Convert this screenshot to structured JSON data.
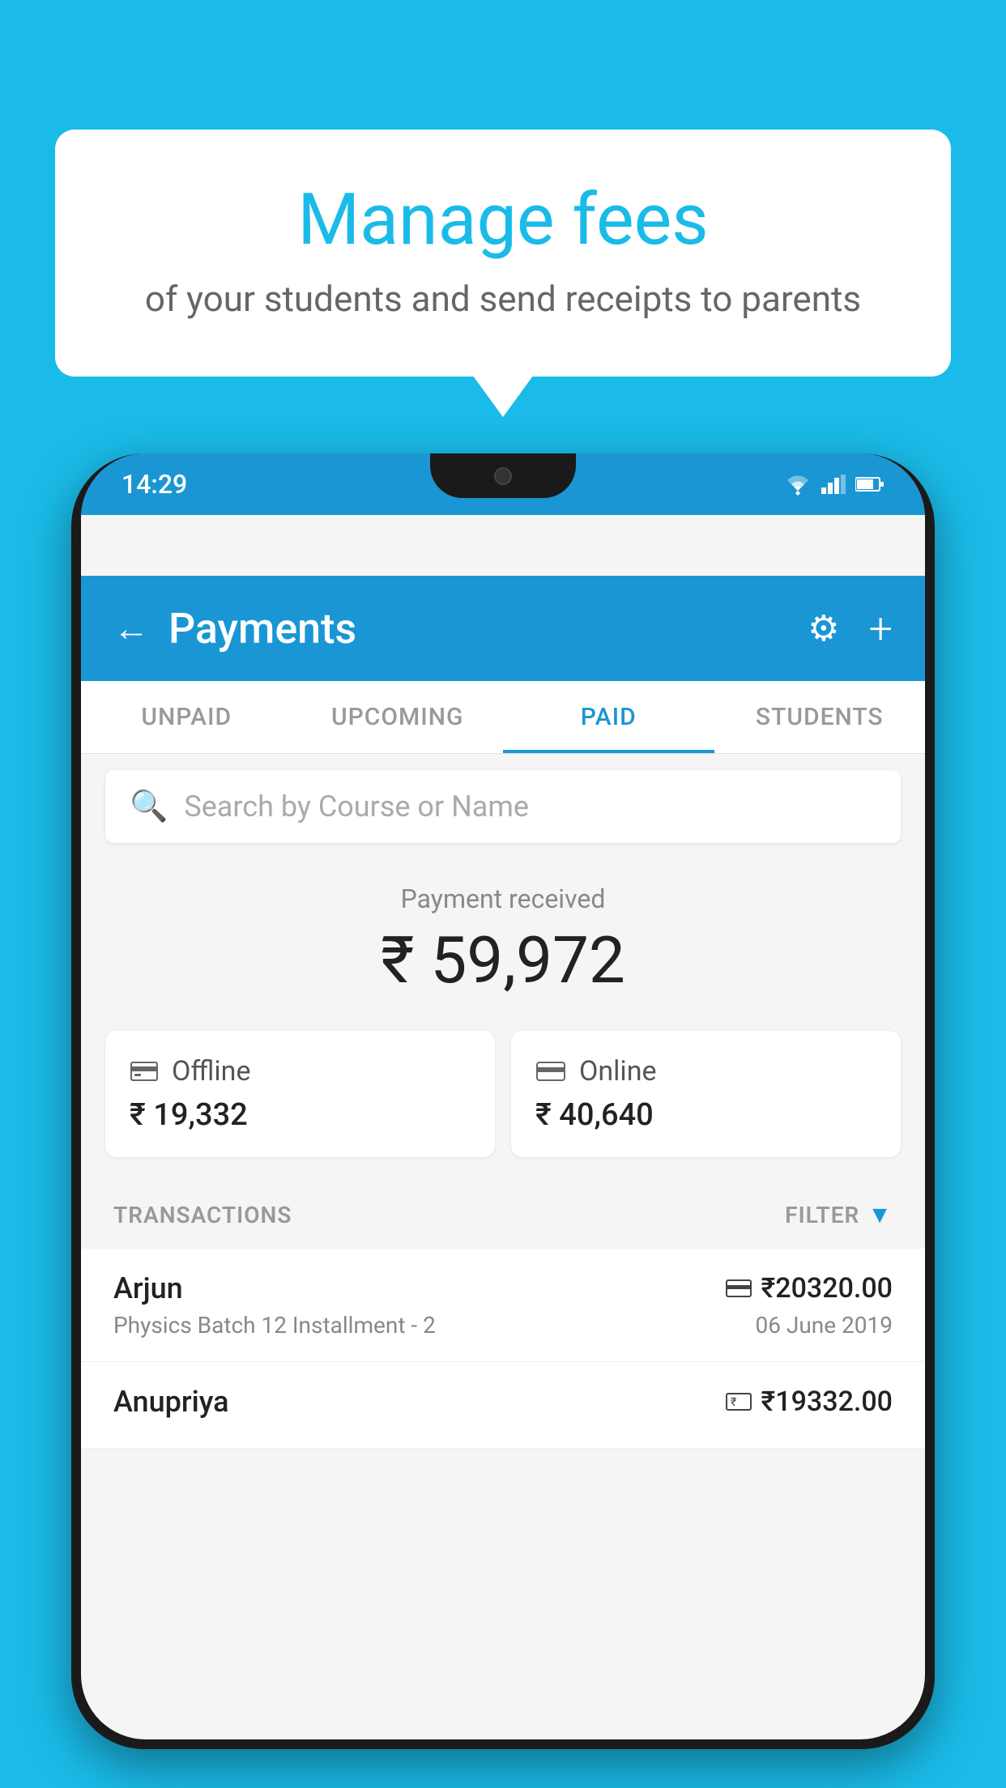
{
  "background_color": "#1ABBE8",
  "speech_bubble": {
    "title": "Manage fees",
    "subtitle": "of your students and send receipts to parents"
  },
  "status_bar": {
    "time": "14:29"
  },
  "header": {
    "title": "Payments",
    "back_label": "←",
    "settings_label": "⚙",
    "add_label": "+"
  },
  "tabs": [
    {
      "label": "UNPAID",
      "active": false
    },
    {
      "label": "UPCOMING",
      "active": false
    },
    {
      "label": "PAID",
      "active": true
    },
    {
      "label": "STUDENTS",
      "active": false
    }
  ],
  "search": {
    "placeholder": "Search by Course or Name"
  },
  "payment_received": {
    "label": "Payment received",
    "amount": "₹ 59,972"
  },
  "payment_cards": [
    {
      "type": "Offline",
      "amount": "₹ 19,332",
      "icon": "offline"
    },
    {
      "type": "Online",
      "amount": "₹ 40,640",
      "icon": "online"
    }
  ],
  "transactions_section": {
    "label": "TRANSACTIONS",
    "filter_label": "FILTER"
  },
  "transactions": [
    {
      "name": "Arjun",
      "course": "Physics Batch 12 Installment - 2",
      "amount": "₹20320.00",
      "date": "06 June 2019",
      "payment_type": "online"
    },
    {
      "name": "Anupriya",
      "course": "",
      "amount": "₹19332.00",
      "date": "",
      "payment_type": "offline"
    }
  ]
}
